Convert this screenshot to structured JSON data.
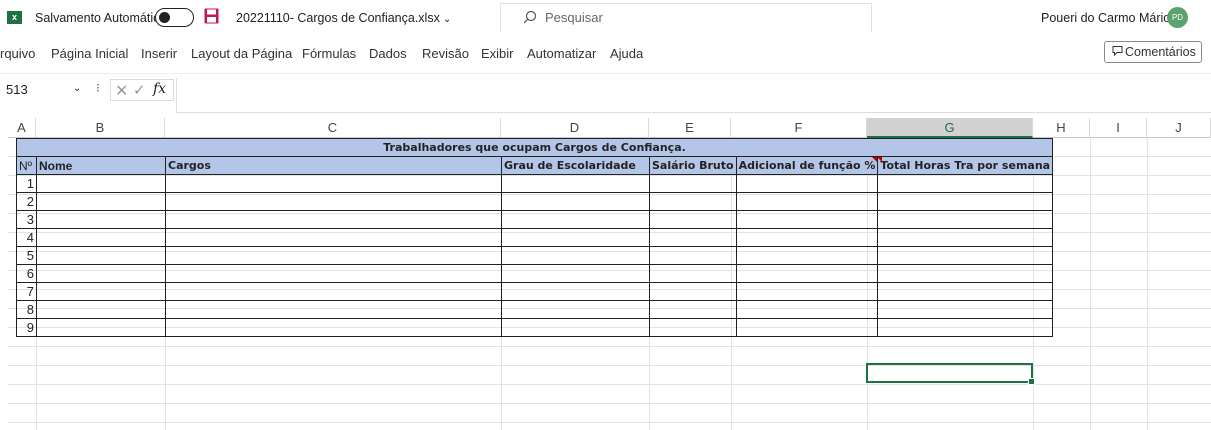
{
  "titlebar": {
    "app_icon": "excel-logo",
    "app_icon_letter": "x",
    "autosave_label": "Salvamento Automático",
    "autosave_state": "off",
    "filename": "20221110- Cargos de Confiança.xlsx",
    "filename_chevron": "⌄",
    "search_placeholder": "Pesquisar",
    "user_name": "Poueri do Carmo Mário",
    "user_initials": "PD"
  },
  "menu": {
    "items": [
      "rquivo",
      "Página Inicial",
      "Inserir",
      "Layout da Página",
      "Fórmulas",
      "Dados",
      "Revisão",
      "Exibir",
      "Automatizar",
      "Ajuda"
    ],
    "comments_label": "Comentários"
  },
  "formula_bar": {
    "name_box": "513",
    "formula": "",
    "fx_label": "fx",
    "separator": "⁝",
    "cancel_glyph": "✕",
    "enter_glyph": "✓"
  },
  "sheet": {
    "columns": [
      "A",
      "B",
      "C",
      "D",
      "E",
      "F",
      "G",
      "H",
      "I",
      "J"
    ],
    "selected_column": "G",
    "table_title": "Trabalhadores que ocupam Cargos de Confiança.",
    "headers": [
      "Nº",
      "Nome",
      "Cargos",
      "Grau de Escolaridade",
      "Salário Bruto",
      "Adicional de função %",
      "Total Horas Tra  por semana"
    ],
    "rows": [
      "1",
      "2",
      "3",
      "4",
      "5",
      "6",
      "7",
      "8",
      "9"
    ],
    "accent_color": "#1e7145",
    "header_fill": "#b4c6e7"
  }
}
